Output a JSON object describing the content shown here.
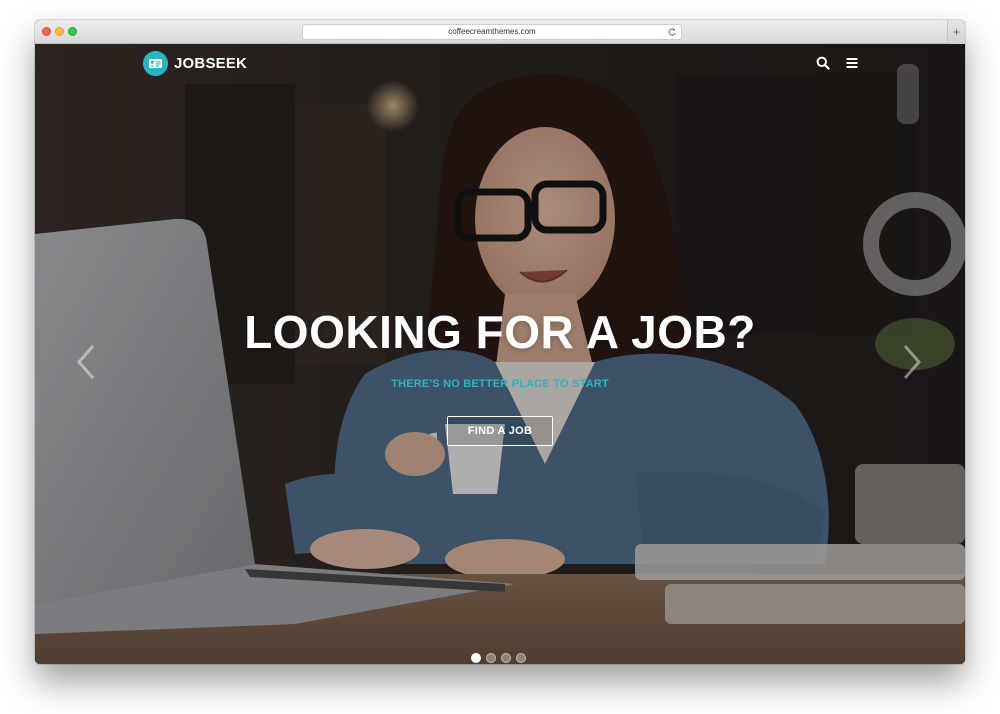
{
  "browser": {
    "url": "coffeecreamthemes.com",
    "new_tab_icon": "+"
  },
  "nav": {
    "logo_text": "JOBSEEK",
    "logo_icon": "id-card-icon",
    "search_icon": "search-icon",
    "menu_icon": "hamburger-menu-icon"
  },
  "hero": {
    "title": "LOOKING FOR A JOB?",
    "subtitle": "THERE'S NO BETTER PLACE TO START",
    "cta_label": "FIND A JOB",
    "prev_icon": "chevron-left-icon",
    "next_icon": "chevron-right-icon",
    "slides_total": 4,
    "active_slide": 1
  },
  "colors": {
    "accent": "#2ab5c4",
    "text_on_image": "#ffffff"
  }
}
